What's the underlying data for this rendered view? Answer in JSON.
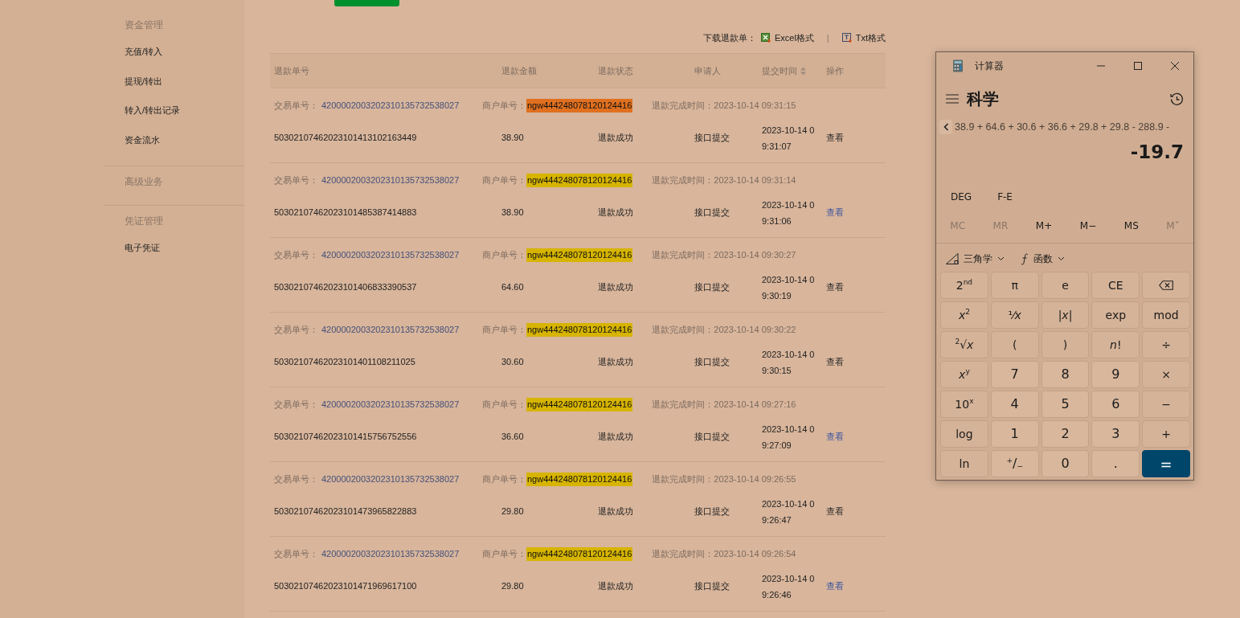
{
  "sidebar": {
    "groups": [
      {
        "heading": "资金管理",
        "items": [
          "充值/转入",
          "提现/转出",
          "转入/转出记录",
          "资金流水"
        ]
      },
      {
        "heading": "高级业务"
      },
      {
        "heading": "凭证管理",
        "items": [
          "电子凭证"
        ]
      }
    ]
  },
  "download": {
    "label": "下载退款单：",
    "links": [
      {
        "kind": "excel",
        "label": "Excel格式"
      },
      {
        "kind": "txt",
        "label": "Txt格式"
      }
    ],
    "separator": "|"
  },
  "table": {
    "columns": [
      {
        "label": "退款单号",
        "kind": "plain"
      },
      {
        "label": "退款金额",
        "kind": "plain"
      },
      {
        "label": "退款状态",
        "kind": "plain"
      },
      {
        "label": "申请人",
        "kind": "plain"
      },
      {
        "label": "提交时间",
        "kind": "sortable"
      },
      {
        "label": "操作",
        "kind": "plain"
      }
    ],
    "rows": [
      {
        "trade_label": "交易单号：",
        "trade_no": "4200002003202310135732538027",
        "merchant_label": "商户单号：",
        "merchant_no": "ngw444248078120124416",
        "color": "#e0701f",
        "done_label": "退款完成时间：",
        "done_time": "2023-10-14 09:31:15",
        "refund_no": "50302107462023101413102163449",
        "amount": "38.90",
        "status": "退款成功",
        "applicant": "接口提交",
        "submit_time": "2023-10-14 09:31:07",
        "action": "查看",
        "visited": true
      },
      {
        "trade_label": "交易单号：",
        "trade_no": "4200002003202310135732538027",
        "merchant_label": "商户单号：",
        "merchant_no": "ngw444248078120124416",
        "color": "#d6b400",
        "done_label": "退款完成时间：",
        "done_time": "2023-10-14 09:31:14",
        "refund_no": "50302107462023101485387414883",
        "amount": "38.90",
        "status": "退款成功",
        "applicant": "接口提交",
        "submit_time": "2023-10-14 09:31:06",
        "action": "查看",
        "visited": false
      },
      {
        "trade_label": "交易单号：",
        "trade_no": "4200002003202310135732538027",
        "merchant_label": "商户单号：",
        "merchant_no": "ngw444248078120124416",
        "color": "#d6b400",
        "done_label": "退款完成时间：",
        "done_time": "2023-10-14 09:30:27",
        "refund_no": "50302107462023101406833390537",
        "amount": "64.60",
        "status": "退款成功",
        "applicant": "接口提交",
        "submit_time": "2023-10-14 09:30:19",
        "action": "查看",
        "visited": true
      },
      {
        "trade_label": "交易单号：",
        "trade_no": "4200002003202310135732538027",
        "merchant_label": "商户单号：",
        "merchant_no": "ngw444248078120124416",
        "color": "#d6b400",
        "done_label": "退款完成时间：",
        "done_time": "2023-10-14 09:30:22",
        "refund_no": "50302107462023101401108211025",
        "amount": "30.60",
        "status": "退款成功",
        "applicant": "接口提交",
        "submit_time": "2023-10-14 09:30:15",
        "action": "查看",
        "visited": true
      },
      {
        "trade_label": "交易单号：",
        "trade_no": "4200002003202310135732538027",
        "merchant_label": "商户单号：",
        "merchant_no": "ngw444248078120124416",
        "color": "#d6b400",
        "done_label": "退款完成时间：",
        "done_time": "2023-10-14 09:27:16",
        "refund_no": "50302107462023101415756752556",
        "amount": "36.60",
        "status": "退款成功",
        "applicant": "接口提交",
        "submit_time": "2023-10-14 09:27:09",
        "action": "查看",
        "visited": false
      },
      {
        "trade_label": "交易单号：",
        "trade_no": "4200002003202310135732538027",
        "merchant_label": "商户单号：",
        "merchant_no": "ngw444248078120124416",
        "color": "#d6b400",
        "done_label": "退款完成时间：",
        "done_time": "2023-10-14 09:26:55",
        "refund_no": "50302107462023101473965822883",
        "amount": "29.80",
        "status": "退款成功",
        "applicant": "接口提交",
        "submit_time": "2023-10-14 09:26:47",
        "action": "查看",
        "visited": true
      },
      {
        "trade_label": "交易单号：",
        "trade_no": "4200002003202310135732538027",
        "merchant_label": "商户单号：",
        "merchant_no": "ngw444248078120124416",
        "color": "#d6b400",
        "done_label": "退款完成时间：",
        "done_time": "2023-10-14 09:26:54",
        "refund_no": "50302107462023101471969617100",
        "amount": "29.80",
        "status": "退款成功",
        "applicant": "接口提交",
        "submit_time": "2023-10-14 09:26:46",
        "action": "查看",
        "visited": false
      }
    ]
  },
  "calculator": {
    "title": "计算器",
    "mode": "科学",
    "expression": "38.9 + 64.6 + 30.6 + 36.6 + 29.8 + 29.8 - 288.9 -",
    "result": "-19.7",
    "toggles": [
      "DEG",
      "F-E"
    ],
    "memory": [
      {
        "label": "MC",
        "disabled": true
      },
      {
        "label": "MR",
        "disabled": true
      },
      {
        "label": "M+",
        "disabled": false
      },
      {
        "label": "M−",
        "disabled": false
      },
      {
        "label": "MS",
        "disabled": false
      },
      {
        "label": "M˅",
        "disabled": true
      }
    ],
    "menus": [
      {
        "kind": "trig",
        "label": "三角学"
      },
      {
        "kind": "func",
        "label": "函数"
      }
    ],
    "keys": [
      {
        "kind": "op",
        "label": "2$^{nd}$"
      },
      {
        "kind": "op",
        "label": "π"
      },
      {
        "kind": "op",
        "label": "e"
      },
      {
        "kind": "op",
        "label": "CE"
      },
      {
        "kind": "backspace"
      },
      {
        "kind": "op",
        "label": "*x*$^{2}$"
      },
      {
        "kind": "op",
        "label": "¹⁄*x*"
      },
      {
        "kind": "op",
        "label": "|*x*|"
      },
      {
        "kind": "op",
        "label": "exp"
      },
      {
        "kind": "op",
        "label": "mod"
      },
      {
        "kind": "op",
        "label": "$^{2}$√*x*"
      },
      {
        "kind": "op",
        "label": "("
      },
      {
        "kind": "op",
        "label": ")"
      },
      {
        "kind": "op",
        "label": "*n*!"
      },
      {
        "kind": "op",
        "label": "÷"
      },
      {
        "kind": "op",
        "label": "*x*$^{y}$"
      },
      {
        "kind": "num",
        "label": "7"
      },
      {
        "kind": "num",
        "label": "8"
      },
      {
        "kind": "num",
        "label": "9"
      },
      {
        "kind": "op",
        "label": "×"
      },
      {
        "kind": "op",
        "label": "10$^{x}$"
      },
      {
        "kind": "num",
        "label": "4"
      },
      {
        "kind": "num",
        "label": "5"
      },
      {
        "kind": "num",
        "label": "6"
      },
      {
        "kind": "op",
        "label": "−"
      },
      {
        "kind": "op",
        "label": "log"
      },
      {
        "kind": "num",
        "label": "1"
      },
      {
        "kind": "num",
        "label": "2"
      },
      {
        "kind": "num",
        "label": "3"
      },
      {
        "kind": "op",
        "label": "+"
      },
      {
        "kind": "op",
        "label": "ln"
      },
      {
        "kind": "num",
        "label": "$^{+}$/$_{−}$"
      },
      {
        "kind": "num",
        "label": "0"
      },
      {
        "kind": "num",
        "label": "."
      },
      {
        "kind": "equals",
        "label": "="
      }
    ]
  }
}
